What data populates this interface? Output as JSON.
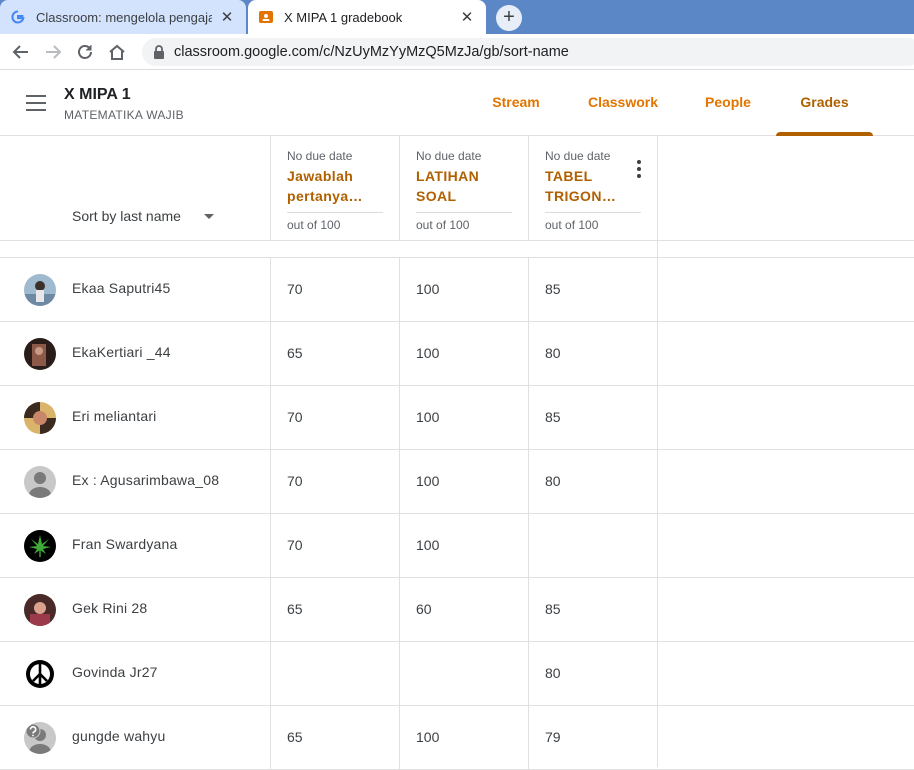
{
  "browser": {
    "tabs": [
      {
        "title": "Classroom: mengelola pengajaran",
        "icon": "google-g-icon"
      },
      {
        "title": "X MIPA 1 gradebook",
        "icon": "classroom-icon"
      }
    ],
    "url": "classroom.google.com/c/NzUyMzYyMzQ5MzJa/gb/sort-name"
  },
  "header": {
    "class_name": "X MIPA 1",
    "class_subject": "MATEMATIKA WAJIB",
    "tabs": [
      "Stream",
      "Classwork",
      "People",
      "Grades"
    ],
    "selected_tab": "Grades"
  },
  "gradebook": {
    "sort_label": "Sort by last name",
    "assignments": [
      {
        "due": "No due date",
        "title": "Jawablah pertanya…",
        "points": "out of 100"
      },
      {
        "due": "No due date",
        "title": "LATIHAN SOAL",
        "points": "out of 100"
      },
      {
        "due": "No due date",
        "title": "TABEL TRIGON…",
        "points": "out of 100"
      }
    ],
    "students": [
      {
        "name": "Ekaa Saputri45",
        "grades": [
          "70",
          "100",
          "85"
        ],
        "avatar": "photo-avatar"
      },
      {
        "name": "EkaKertiari _44",
        "grades": [
          "65",
          "100",
          "80"
        ],
        "avatar": "photo-avatar"
      },
      {
        "name": "Eri meliantari",
        "grades": [
          "70",
          "100",
          "85"
        ],
        "avatar": "photo-avatar"
      },
      {
        "name": "Ex : Agusarimbawa_08",
        "grades": [
          "70",
          "100",
          "80"
        ],
        "avatar": "default-person-avatar"
      },
      {
        "name": "Fran Swardyana",
        "grades": [
          "70",
          "100",
          ""
        ],
        "avatar": "leaf-avatar"
      },
      {
        "name": "Gek Rini 28",
        "grades": [
          "65",
          "60",
          "85"
        ],
        "avatar": "photo-avatar"
      },
      {
        "name": "Govinda Jr27",
        "grades": [
          "",
          "",
          "80"
        ],
        "avatar": "peace-sign-avatar"
      },
      {
        "name": "gungde wahyu",
        "grades": [
          "65",
          "100",
          "79"
        ],
        "avatar": "question-mark-avatar"
      }
    ]
  },
  "colors": {
    "accent": "#e37400",
    "accent_dark": "#b06000",
    "tabstrip": "#5b87c6"
  }
}
